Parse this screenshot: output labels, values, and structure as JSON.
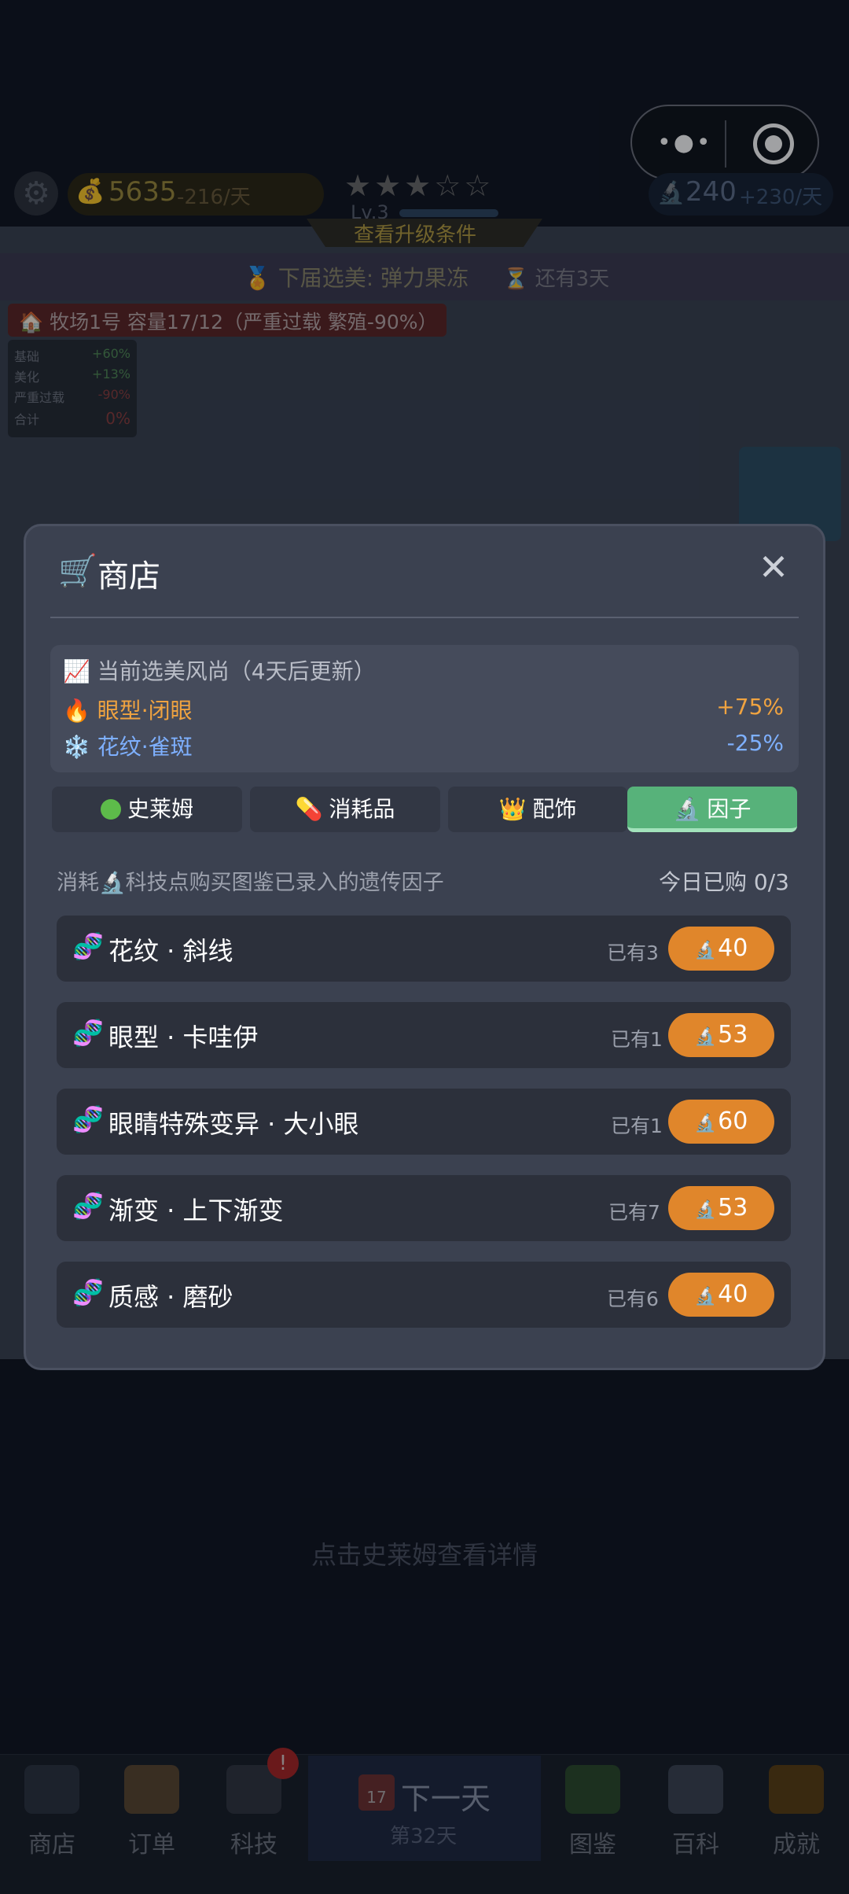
{
  "topbar": {
    "coins": "5635",
    "coin_rate": "-216/天",
    "stars": "★★★☆☆",
    "level": "Lv.3",
    "tech_points": "240",
    "tech_rate": "+230/天",
    "upgrade_link": "查看升级条件"
  },
  "contest": {
    "next": "🏅 下届选美: 弹力果冻",
    "remaining": "⏳ 还有3天"
  },
  "ranch": {
    "label": "🏠 牧场1号  容量17/12（严重过载 繁殖-90%）",
    "stats": [
      {
        "k": "基础",
        "v": "+60%"
      },
      {
        "k": "美化",
        "v": "+13%"
      },
      {
        "k": "严重过载",
        "v": "-90%"
      },
      {
        "k": "合计",
        "v": "0%"
      }
    ]
  },
  "hint": "点击史莱姆查看详情",
  "modal": {
    "title_icon": "🛒",
    "title": "商店",
    "close": "✕",
    "trend": {
      "header": "📈 当前选美风尚（4天后更新）",
      "rows": [
        {
          "label": "🔥 眼型·闭眼",
          "value": "+75%",
          "color": "#f0a340"
        },
        {
          "label": "❄️ 花纹·雀斑",
          "value": "-25%",
          "color": "#7eb0ff"
        }
      ]
    },
    "tabs": [
      {
        "label": "史莱姆",
        "icon": "green-dot"
      },
      {
        "label": "消耗品",
        "icon": "💊"
      },
      {
        "label": "配饰",
        "icon": "👑"
      },
      {
        "label": "因子",
        "icon": "🔬"
      }
    ],
    "active_tab": "因子",
    "description": "消耗🔬科技点购买图鉴已录入的遗传因子",
    "bought_today": "今日已购 0/3",
    "items": [
      {
        "name": "花纹 · 斜线",
        "owned": "已有3",
        "price": "40"
      },
      {
        "name": "眼型 · 卡哇伊",
        "owned": "已有1",
        "price": "53"
      },
      {
        "name": "眼睛特殊变异 · 大小眼",
        "owned": "已有1",
        "price": "60"
      },
      {
        "name": "渐变 · 上下渐变",
        "owned": "已有7",
        "price": "53"
      },
      {
        "name": "质感 · 磨砂",
        "owned": "已有6",
        "price": "40"
      }
    ],
    "price_icon": "🔬",
    "item_icon": "🧬"
  },
  "bottom_nav": {
    "items": [
      {
        "label": "商店",
        "icon": "cart-icon"
      },
      {
        "label": "订单",
        "icon": "scroll-icon"
      },
      {
        "label": "科技",
        "icon": "microscope-icon",
        "badge": "!"
      },
      {
        "label": "图鉴",
        "icon": "book-icon"
      },
      {
        "label": "百科",
        "icon": "open-book-icon"
      },
      {
        "label": "成就",
        "icon": "trophy-icon"
      }
    ],
    "next_day": {
      "label": "下一天",
      "day": "第32天",
      "calendar": "17"
    }
  }
}
